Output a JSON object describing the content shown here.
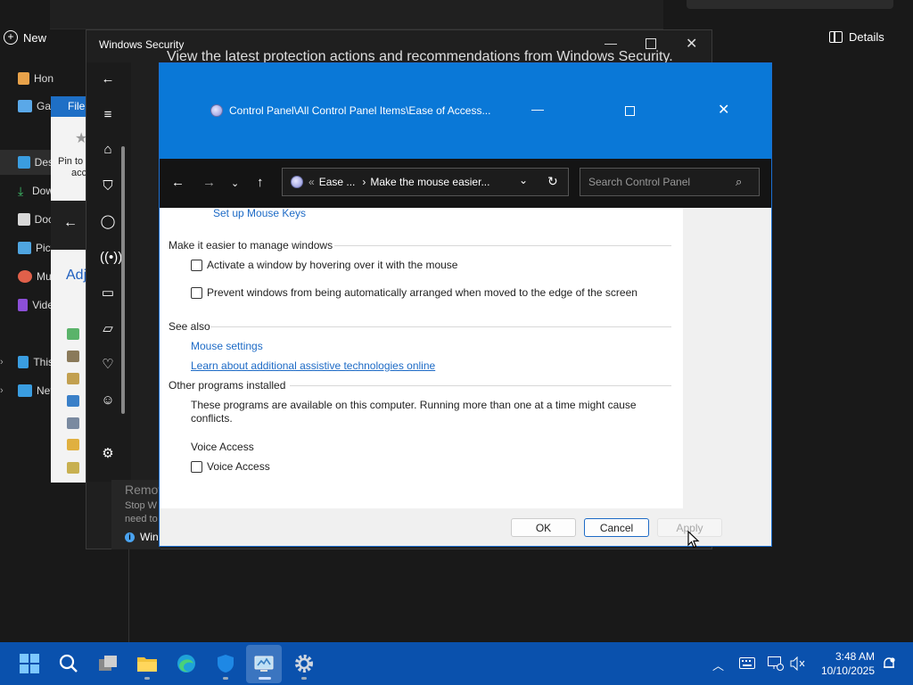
{
  "explorer": {
    "new_label": "New",
    "details_label": "Details",
    "nav": [
      {
        "label": "Hon",
        "icon": "home-icon"
      },
      {
        "label": "Gal",
        "icon": "gallery-icon"
      },
      {
        "label": "Des",
        "icon": "desktop-folder-icon"
      },
      {
        "label": "Dow",
        "icon": "downloads-icon"
      },
      {
        "label": "Doc",
        "icon": "documents-icon"
      },
      {
        "label": "Pict",
        "icon": "pictures-icon"
      },
      {
        "label": "Mu",
        "icon": "music-icon"
      },
      {
        "label": "Vide",
        "icon": "videos-icon"
      },
      {
        "label": "This",
        "icon": "this-pc-icon"
      },
      {
        "label": "Net",
        "icon": "network-icon"
      }
    ]
  },
  "background_panel": {
    "file_tab": "File",
    "pin_text": "Pin to",
    "pin_text2": "acc",
    "adjust_heading": "Adj"
  },
  "windows_security": {
    "title": "Windows Security",
    "heading": "View the latest protection actions and recommendations from Windows Security.",
    "notification_title": "Remov",
    "notification_text1": "Stop W",
    "notification_text2": "need to",
    "notification_link": "Win"
  },
  "control_panel": {
    "title": "Control Panel\\All Control Panel Items\\Ease of Access...",
    "address_sep": "«",
    "address_ease": "Ease ...",
    "address_current": "Make the mouse easier...",
    "search_placeholder": "Search Control Panel",
    "mouse_keys_link": "Set up Mouse Keys",
    "windows_section": "Make it easier to manage windows",
    "option_hover": "Activate a window by hovering over it with the mouse",
    "option_snap": "Prevent windows from being automatically arranged when moved to the edge of the screen",
    "see_also": "See also",
    "mouse_settings_link": "Mouse settings",
    "assistive_link": "Learn about additional assistive technologies online",
    "other_programs": "Other programs installed",
    "programs_text": "These programs are available on this computer. Running more than one at a time might cause conflicts.",
    "voice_access_heading": "Voice Access",
    "voice_access_option": "Voice Access",
    "ok": "OK",
    "cancel": "Cancel",
    "apply": "Apply"
  },
  "taskbar": {
    "time": "3:48 AM",
    "date": "10/10/2025"
  },
  "colors": {
    "accent": "#0a78d7",
    "taskbar": "#0a51ad",
    "link": "#1e6bc6"
  }
}
